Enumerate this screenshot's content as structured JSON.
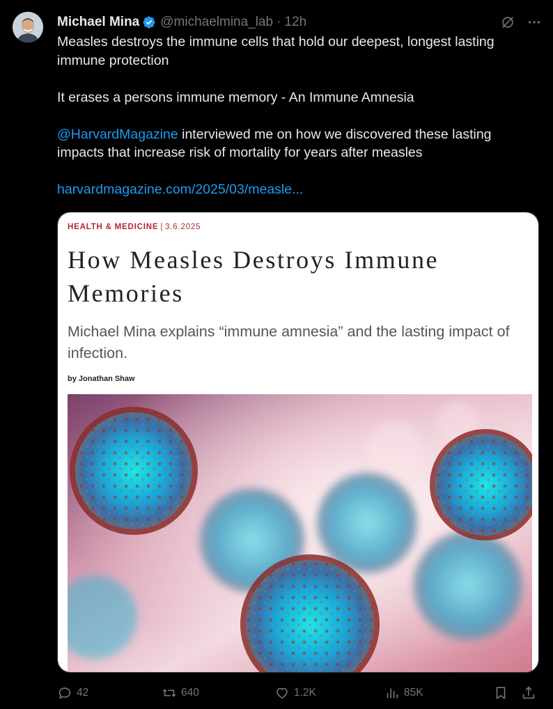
{
  "author": {
    "name": "Michael Mina",
    "handle": "@michaelmina_lab",
    "separator": "·",
    "time": "12h",
    "verified": true
  },
  "tweet": {
    "line1": "Measles destroys the immune cells that hold our deepest, longest lasting immune protection",
    "line2": "It erases a persons immune memory - An Immune Amnesia",
    "mention": "@HarvardMagazine",
    "line3_rest": " interviewed me on how we discovered these lasting impacts that increase risk of mortality for years after measles",
    "link": "harvardmagazine.com/2025/03/measle..."
  },
  "card": {
    "kicker": "HEALTH & MEDICINE",
    "kicker_sep": "|",
    "date": "3.6.2025",
    "headline": "How Measles Destroys Immune Memories",
    "dek": "Michael Mina explains “immune amnesia” and the lasting impact of infection.",
    "byline": "by Jonathan Shaw"
  },
  "actions": {
    "replies": "42",
    "reposts": "640",
    "likes": "1.2K",
    "views": "85K"
  },
  "colors": {
    "background": "#000000",
    "link": "#1d9bf0",
    "muted": "#71767b",
    "kicker": "#b3282d"
  },
  "icons": [
    "verified-badge-icon",
    "grok-icon",
    "more-icon",
    "reply-icon",
    "repost-icon",
    "like-icon",
    "views-icon",
    "bookmark-icon",
    "share-icon"
  ]
}
